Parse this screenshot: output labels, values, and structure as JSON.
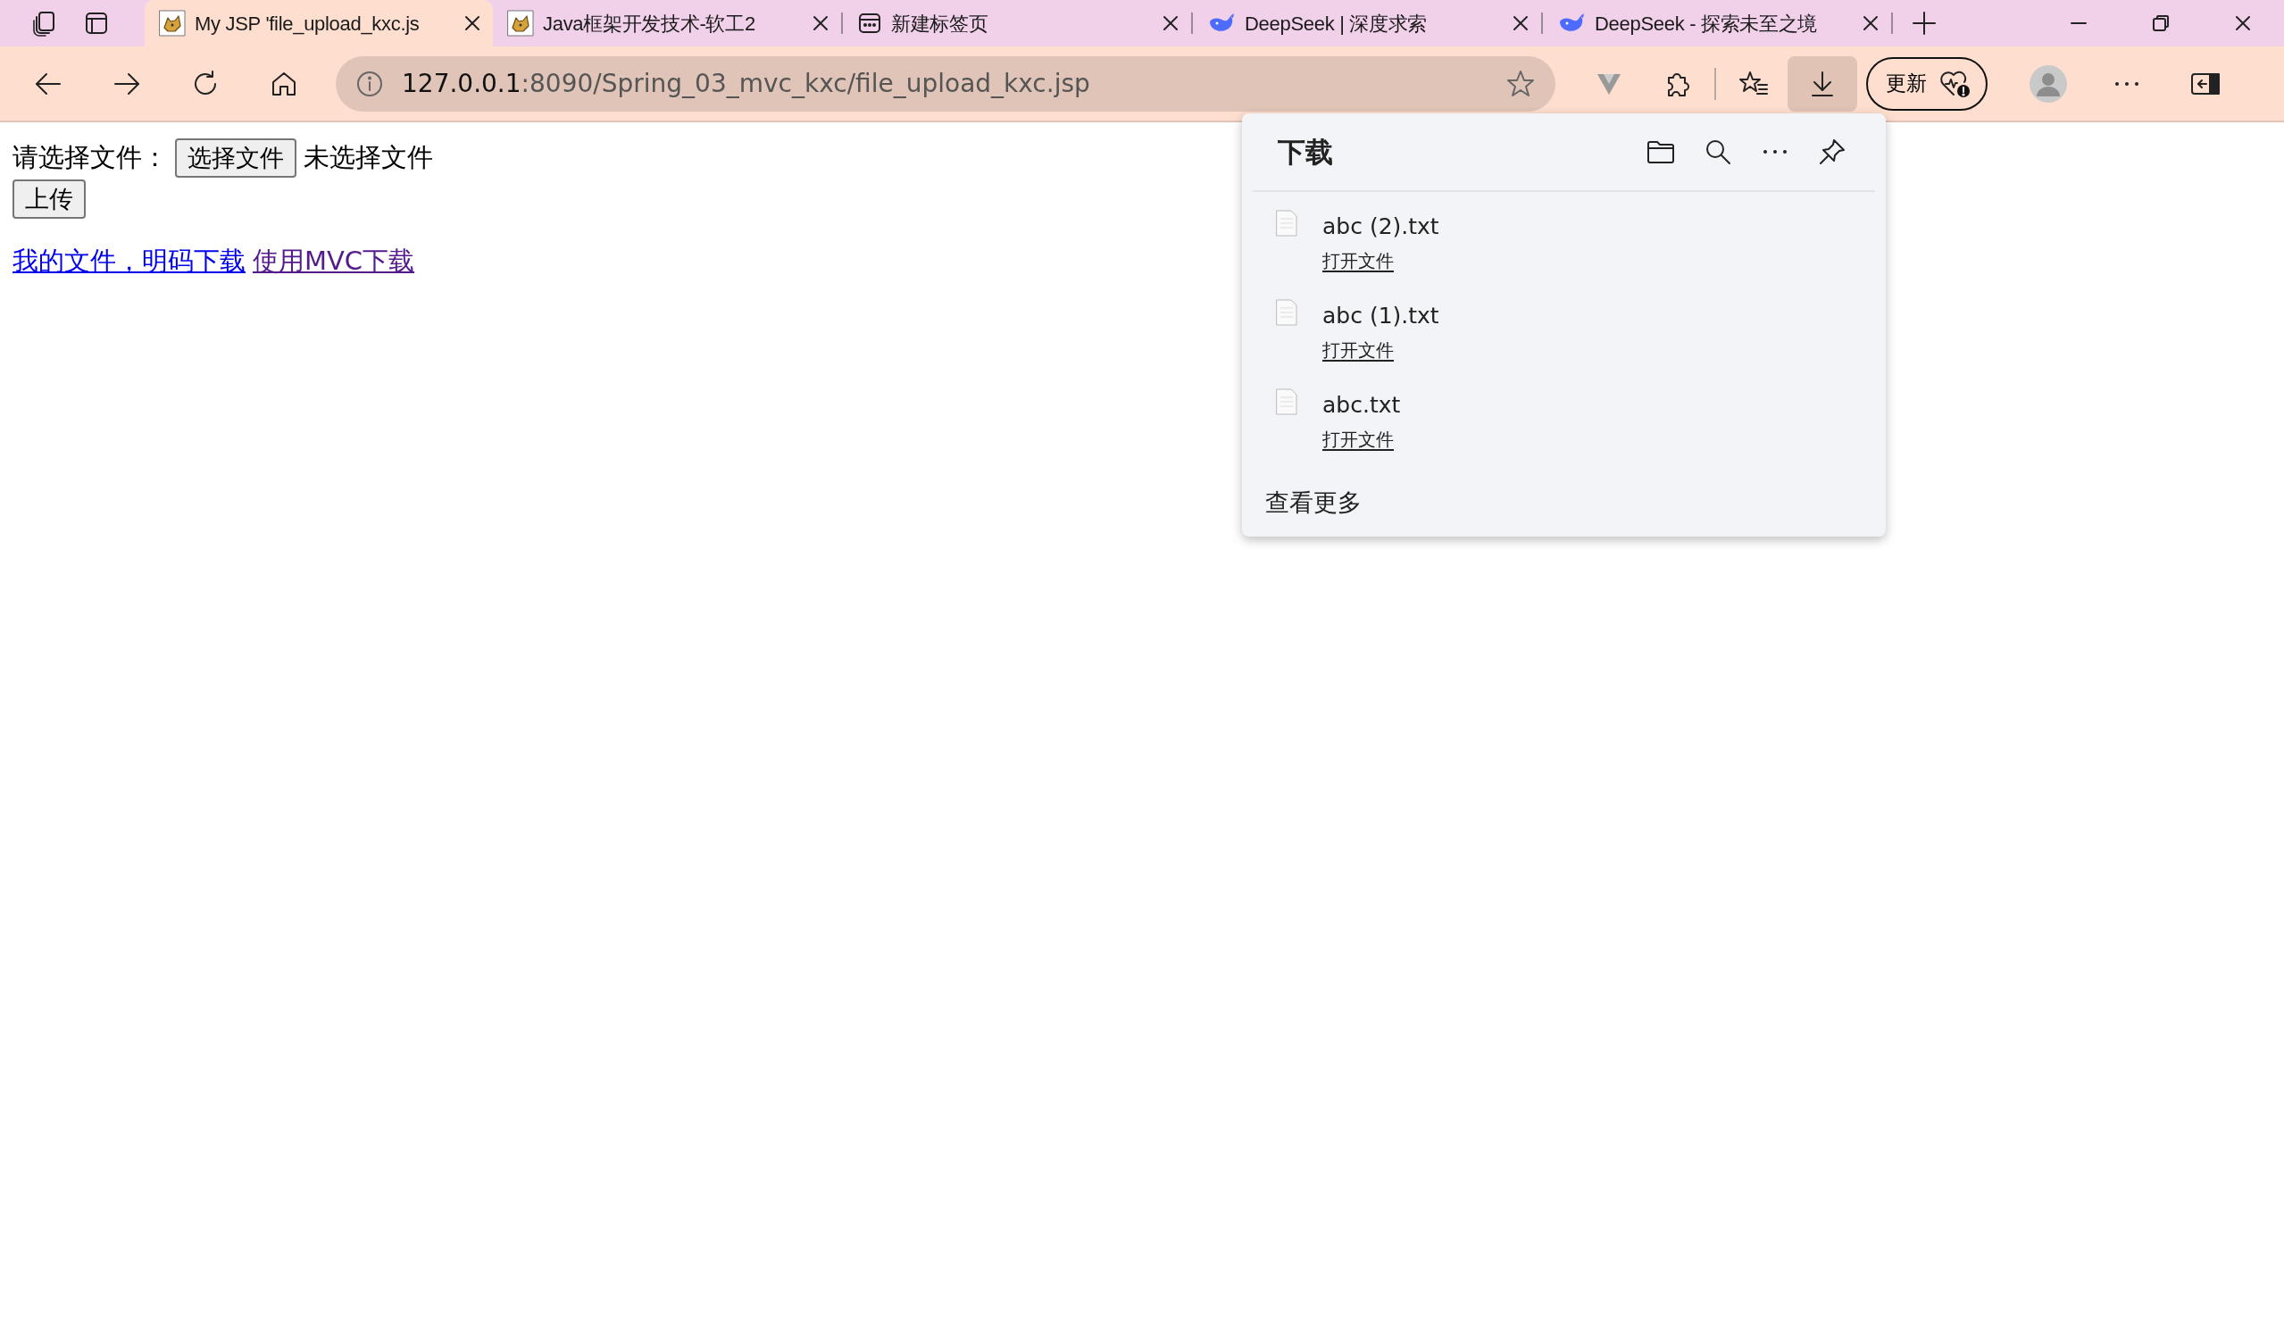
{
  "tabs": [
    {
      "title": "My JSP 'file_upload_kxc.js",
      "kind": "tomcat",
      "selected": true
    },
    {
      "title": "Java框架开发技术-软工2",
      "kind": "tomcat",
      "selected": false
    },
    {
      "title": "新建标签页",
      "kind": "newtab",
      "selected": false
    },
    {
      "title": "DeepSeek | 深度求索",
      "kind": "whale",
      "selected": false
    },
    {
      "title": "DeepSeek - 探索未至之境",
      "kind": "whale",
      "selected": false
    }
  ],
  "address": {
    "host": "127.0.0.1",
    "path": ":8090/Spring_03_mvc_kxc/file_upload_kxc.jsp"
  },
  "update_button": "更新",
  "downloads_open": true,
  "page": {
    "label": "请选择文件：",
    "choose_button": "选择文件",
    "file_status": "未选择文件",
    "upload_button": "上传",
    "links": [
      {
        "text": "我的文件，明码下载",
        "visited": false
      },
      {
        "text": "使用MVC下载",
        "visited": true
      }
    ]
  },
  "downloads": {
    "title": "下载",
    "items": [
      {
        "name": "abc (2).txt",
        "action": "打开文件"
      },
      {
        "name": "abc (1).txt",
        "action": "打开文件"
      },
      {
        "name": "abc.txt",
        "action": "打开文件"
      }
    ],
    "more": "查看更多"
  }
}
